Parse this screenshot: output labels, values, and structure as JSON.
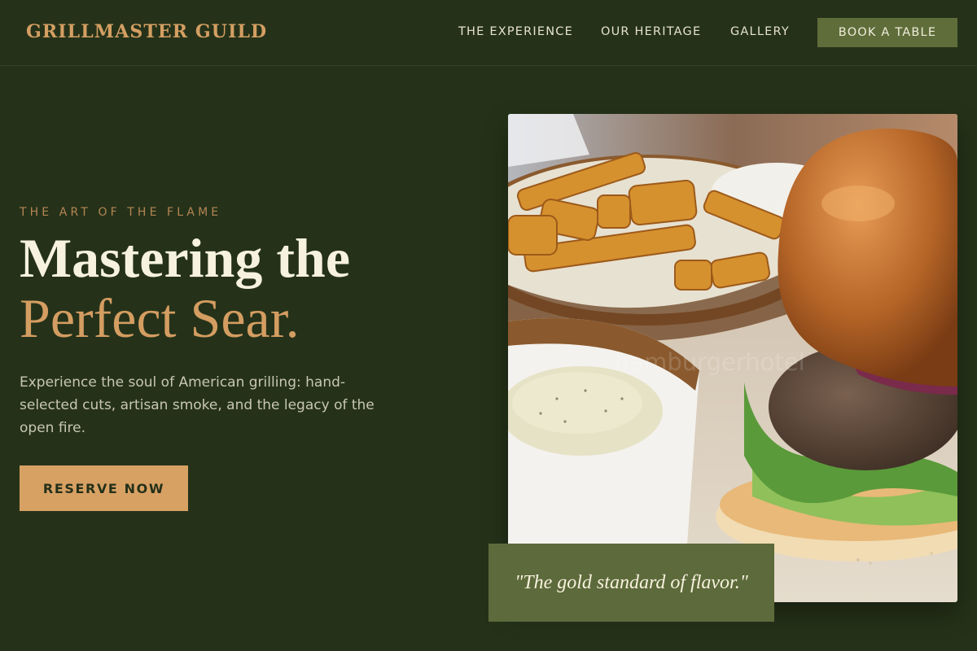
{
  "brand": {
    "logo_text": "GRILLMASTER GUILD"
  },
  "nav": {
    "links": [
      {
        "label": "THE EXPERIENCE"
      },
      {
        "label": "OUR HERITAGE"
      },
      {
        "label": "GALLERY"
      }
    ],
    "cta_label": "BOOK A TABLE"
  },
  "hero": {
    "kicker": "THE ART OF THE FLAME",
    "headline_line1": "Mastering the",
    "headline_line2": "Perfect Sear.",
    "description": "Experience the soul of American grilling: hand-selected cuts, artisan smoke, and the legacy of the open fire.",
    "button_label": "RESERVE NOW"
  },
  "image": {
    "watermark": "hamburgerhotel",
    "subject": "burger-fries-dip-photo"
  },
  "quote": {
    "text": "\"The gold standard of flavor.\""
  },
  "colors": {
    "background": "#253219",
    "accent": "#d8a164",
    "olive": "#5e6d3a",
    "heading_light": "#f7f2de"
  }
}
